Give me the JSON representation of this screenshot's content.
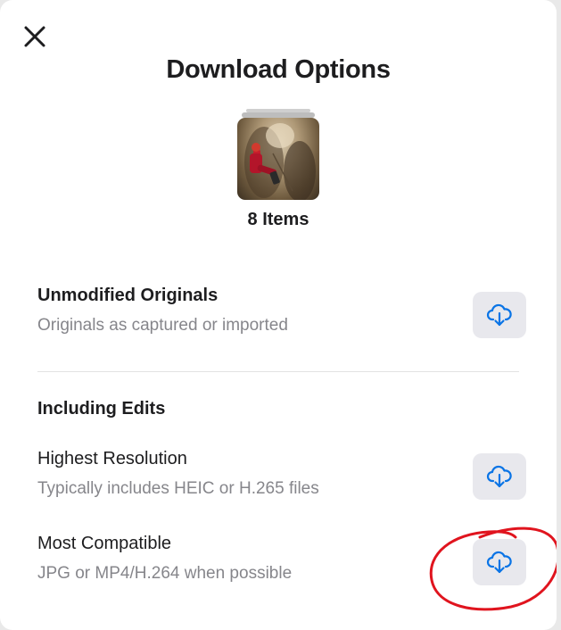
{
  "dialog": {
    "title": "Download Options",
    "items_count": "8 Items"
  },
  "options": {
    "unmodified": {
      "title": "Unmodified Originals",
      "subtitle": "Originals as captured or imported"
    },
    "section_heading": "Including Edits",
    "highest": {
      "title": "Highest Resolution",
      "subtitle": "Typically includes HEIC or H.265 files"
    },
    "compatible": {
      "title": "Most Compatible",
      "subtitle": "JPG or MP4/H.264 when possible"
    }
  },
  "icons": {
    "close": "close-icon",
    "download": "cloud-download-icon"
  },
  "colors": {
    "accent": "#0a74e6",
    "annotation": "#e0141e",
    "button_bg": "#e8e8ed"
  }
}
